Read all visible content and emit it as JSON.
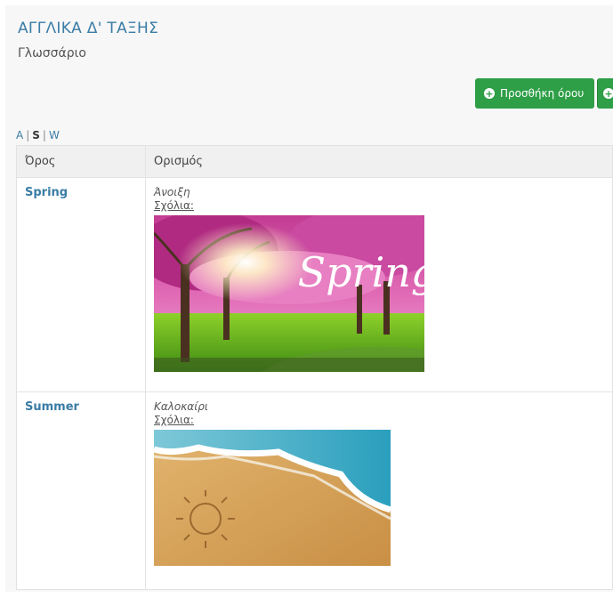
{
  "course": {
    "title": "ΑΓΓΛΙΚΑ Δ' ΤΑΞΗΣ",
    "subtitle": "Γλωσσάριο"
  },
  "toolbar": {
    "add_term_label": "Προσθήκη όρου"
  },
  "letter_index": {
    "items": [
      "A",
      "S",
      "W"
    ],
    "active": "S",
    "separator": "|"
  },
  "table": {
    "headers": {
      "term": "Όρος",
      "definition": "Ορισμός"
    },
    "rows": [
      {
        "term": "Spring",
        "definition": "Άνοιξη",
        "comments_label": "Σχόλια:",
        "image": "spring-blossom-trees",
        "image_overlay_text": "Spring"
      },
      {
        "term": "Summer",
        "definition": "Καλοκαίρι",
        "comments_label": "Σχόλια:",
        "image": "beach-sun-drawing-in-sand"
      }
    ]
  },
  "colors": {
    "accent": "#3a7ca5",
    "button_green": "#2e9e47"
  }
}
